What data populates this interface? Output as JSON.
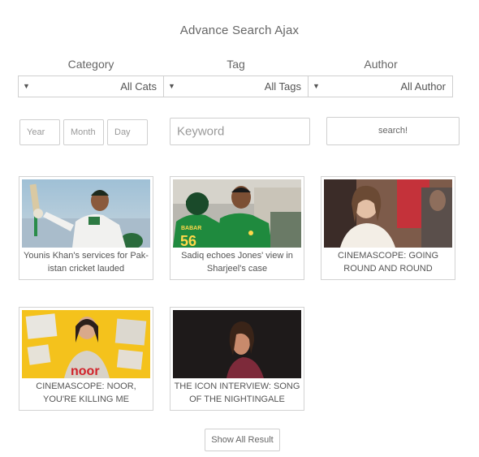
{
  "page": {
    "title": "Advance Search Ajax"
  },
  "filters": {
    "category": {
      "label": "Category",
      "value": "All Cats"
    },
    "tag": {
      "label": "Tag",
      "value": "All Tags"
    },
    "author": {
      "label": "Author",
      "value": "All Author"
    }
  },
  "inputs": {
    "year_placeholder": "Year",
    "month_placeholder": "Month",
    "day_placeholder": "Day",
    "keyword_placeholder": "Keyword",
    "search_label": "search!"
  },
  "results": [
    {
      "caption": "Younis Khan's services for Pak-istan cricket lauded"
    },
    {
      "caption": "Sadiq echoes Jones' view in Sharjeel's case"
    },
    {
      "caption": "CINEMASCOPE: GOING ROUND AND ROUND"
    },
    {
      "caption": "CINEMASCOPE: NOOR, YOU'RE KILLING ME"
    },
    {
      "caption": "THE ICON INTERVIEW: SONG OF THE NIGHTINGALE"
    }
  ],
  "jersey": {
    "name": "BABAR",
    "number": "56"
  },
  "poster_title": "noor",
  "show_all_label": "Show All Result",
  "colors": {
    "border": "#cfcfcf",
    "text": "#555555",
    "pak_green": "#1f7a3a"
  }
}
